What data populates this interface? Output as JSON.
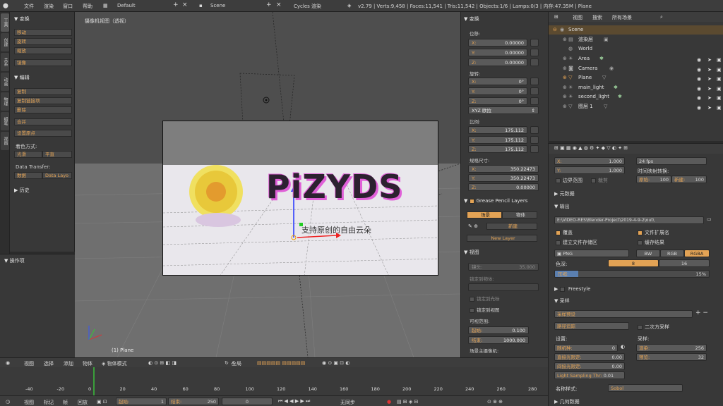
{
  "topbar": {
    "menus": [
      "文件",
      "渲染",
      "窗口",
      "帮助"
    ],
    "layout": "Default",
    "scene": "Scene",
    "engine": "Cycles 渲染",
    "stats": "v2.79 | Verts:9,458 | Faces:11,541 | Tris:11,542 | Objects:1/6 | Lamps:0/3 | 内存:47.35M | Plane"
  },
  "left_tabs": [
    "工具",
    "创建",
    "关系",
    "动画",
    "物理",
    "蜡笔",
    "视图"
  ],
  "tools": {
    "transform_header": "变换",
    "transform_buttons": [
      "移动",
      "旋转",
      "缩放"
    ],
    "mirror": "镜像",
    "edit_header": "编辑",
    "edit_buttons": [
      "复制",
      "复制链接项",
      "删除"
    ],
    "join": "合并",
    "origin": "设置原点",
    "shading_label": "着色方式:",
    "shade_smooth": "光滑",
    "shade_flat": "平直",
    "data_transfer_label": "Data Transfer:",
    "data_btn": "数据",
    "data_layout_btn": "Data Layo",
    "history_header": "历史"
  },
  "operator_panel": {
    "title": "操作项"
  },
  "viewport": {
    "label": "摄像机视图（透视）",
    "object_label": "(1) Plane",
    "logo_text": "PiZYDS",
    "logo_subtitle": "支持原创的自由云朵"
  },
  "properties_n": {
    "transform_header": "变换",
    "location_label": "位移:",
    "location": [
      {
        "axis": "X:",
        "value": "0.00000"
      },
      {
        "axis": "Y:",
        "value": "0.00000"
      },
      {
        "axis": "Z:",
        "value": "0.00000"
      }
    ],
    "rotation_label": "旋转:",
    "rotation": [
      {
        "axis": "X:",
        "value": "0°"
      },
      {
        "axis": "Y:",
        "value": "0°"
      },
      {
        "axis": "Z:",
        "value": "0°"
      }
    ],
    "rotation_mode": "XYZ 欧拉",
    "scale_label": "比例:",
    "scale": [
      {
        "axis": "X:",
        "value": "175.112"
      },
      {
        "axis": "Y:",
        "value": "175.112"
      },
      {
        "axis": "Z:",
        "value": "175.112"
      }
    ],
    "dimensions_label": "规格尺寸:",
    "dimensions": [
      {
        "axis": "X:",
        "value": "350.22473"
      },
      {
        "axis": "Y:",
        "value": "350.22473"
      },
      {
        "axis": "Z:",
        "value": "0.00000"
      }
    ],
    "grease_header": "Grease Pencil Layers",
    "grease_scene": "场景",
    "grease_object": "物体",
    "grease_new": "新建",
    "grease_new_layer": "New Layer",
    "view_header": "视图",
    "lens_label": "镜头:",
    "lens_value": "35.000",
    "lock_object_label": "锁定到物体:",
    "lock_cursor": "锁定到光标",
    "lock_view": "锁定到视图",
    "clip_label": "可视范围:",
    "clip_start_label": "起始:",
    "clip_start": "0.100",
    "clip_end_label": "结束:",
    "clip_end": "1000.000",
    "local_camera": "场景主摄像机:"
  },
  "outliner": {
    "view": "视图",
    "search": "搜索",
    "all_scenes": "所有场景",
    "items": [
      {
        "name": "Scene",
        "indent": 0
      },
      {
        "name": "渲染层",
        "indent": 1
      },
      {
        "name": "World",
        "indent": 1
      },
      {
        "name": "Area",
        "indent": 1
      },
      {
        "name": "Camera",
        "indent": 1
      },
      {
        "name": "Plane",
        "indent": 1
      },
      {
        "name": "main_light",
        "indent": 1
      },
      {
        "name": "second_light",
        "indent": 1
      },
      {
        "name": "图层 1",
        "indent": 1
      }
    ]
  },
  "render_props": {
    "x_label": "X:",
    "x_value": "1.000",
    "y_label": "Y:",
    "y_value": "1.000",
    "fps": "24 fps",
    "time_remap": "时间映射转换:",
    "border": "边界范围",
    "crop": "裁剪",
    "old_label": "原始:",
    "old_value": "100",
    "new_label": "新建:",
    "new_value": "100",
    "metadata_header": "元数据",
    "output_header": "输出",
    "output_path": "E:\\VIDEO-RES\\Blender-Project\\2019-4-9-2\\out\\",
    "overwrite": "覆盖",
    "file_ext": "文件扩展名",
    "placeholders": "建立文件存储区",
    "cache_result": "缓存结果",
    "format": "PNG",
    "bw": "BW",
    "rgb": "RGB",
    "rgba": "RGBA",
    "color_depth_label": "色深:",
    "depth_8": "8",
    "depth_16": "16",
    "compression_label": "压缩:",
    "compression_value": "15%",
    "freestyle_header": "Freestyle",
    "sampling_header": "采样",
    "sampling_preset": "采样预设",
    "integrator": "路径追踪",
    "square_samples": "二次方采样",
    "settings_label": "设置:",
    "samples_label": "采样:",
    "seed_label": "随机种:",
    "seed_value": "0",
    "render_label": "渲染:",
    "render_value": "256",
    "clamp_direct_label": "直接光限定:",
    "clamp_direct_value": "0.00",
    "preview_label": "预览:",
    "preview_value": "32",
    "clamp_indirect_label": "间接光限定:",
    "clamp_indirect_value": "0.00",
    "light_sampling_label": "Light Sampling Thr:",
    "light_sampling_value": "0.01",
    "pattern_label": "名称样式:",
    "pattern_value": "Sobol",
    "geometry_header": "几何数据"
  },
  "viewport_header": {
    "items": [
      "视图",
      "选择",
      "添加",
      "物体"
    ],
    "mode": "物体模式",
    "global": "全局"
  },
  "timeline": {
    "ticks": [
      "-40",
      "-20",
      "0",
      "20",
      "40",
      "60",
      "80",
      "100",
      "120",
      "140",
      "160",
      "180",
      "200",
      "220",
      "240",
      "260",
      "280"
    ]
  },
  "timeline_header": {
    "items": [
      "视图",
      "标记",
      "帧",
      "回放"
    ],
    "start_label": "起始:",
    "start_value": "1",
    "end_label": "结束:",
    "end_value": "250",
    "current": "0",
    "sync": "无同步"
  }
}
